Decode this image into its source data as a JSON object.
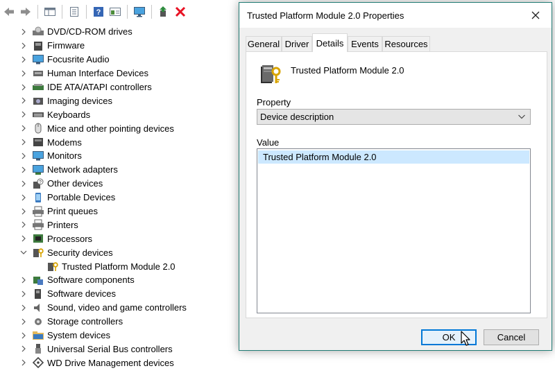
{
  "toolbar": {
    "icons": [
      "back-arrow-icon",
      "forward-arrow-icon",
      "console-tree-icon",
      "properties-icon",
      "help-icon",
      "view-icon",
      "monitor-icon",
      "update-driver-icon",
      "uninstall-icon"
    ]
  },
  "tree": {
    "items": [
      {
        "label": "DVD/CD-ROM drives",
        "icon": "dvd-drive-icon",
        "expanded": false
      },
      {
        "label": "Firmware",
        "icon": "firmware-icon",
        "expanded": false
      },
      {
        "label": "Focusrite Audio",
        "icon": "monitor-icon",
        "expanded": false
      },
      {
        "label": "Human Interface Devices",
        "icon": "hid-icon",
        "expanded": false
      },
      {
        "label": "IDE ATA/ATAPI controllers",
        "icon": "ide-controller-icon",
        "expanded": false
      },
      {
        "label": "Imaging devices",
        "icon": "camera-icon",
        "expanded": false
      },
      {
        "label": "Keyboards",
        "icon": "keyboard-icon",
        "expanded": false
      },
      {
        "label": "Mice and other pointing devices",
        "icon": "mouse-icon",
        "expanded": false
      },
      {
        "label": "Modems",
        "icon": "modem-icon",
        "expanded": false
      },
      {
        "label": "Monitors",
        "icon": "monitor-icon",
        "expanded": false
      },
      {
        "label": "Network adapters",
        "icon": "network-icon",
        "expanded": false
      },
      {
        "label": "Other devices",
        "icon": "unknown-device-icon",
        "expanded": false
      },
      {
        "label": "Portable Devices",
        "icon": "portable-device-icon",
        "expanded": false
      },
      {
        "label": "Print queues",
        "icon": "printer-icon",
        "expanded": false
      },
      {
        "label": "Printers",
        "icon": "printer-icon",
        "expanded": false
      },
      {
        "label": "Processors",
        "icon": "processor-icon",
        "expanded": false
      },
      {
        "label": "Security devices",
        "icon": "security-key-icon",
        "expanded": true
      },
      {
        "label": "Trusted Platform Module 2.0",
        "icon": "security-key-icon",
        "child": true
      },
      {
        "label": "Software components",
        "icon": "software-component-icon",
        "expanded": false
      },
      {
        "label": "Software devices",
        "icon": "software-device-icon",
        "expanded": false
      },
      {
        "label": "Sound, video and game controllers",
        "icon": "speaker-icon",
        "expanded": false
      },
      {
        "label": "Storage controllers",
        "icon": "storage-gear-icon",
        "expanded": false
      },
      {
        "label": "System devices",
        "icon": "folder-icon",
        "expanded": false
      },
      {
        "label": "Universal Serial Bus controllers",
        "icon": "usb-icon",
        "expanded": false
      },
      {
        "label": "WD Drive Management devices",
        "icon": "wd-diamond-icon",
        "expanded": false
      }
    ]
  },
  "dialog": {
    "title": "Trusted Platform Module 2.0 Properties",
    "tabs": [
      "General",
      "Driver",
      "Details",
      "Events",
      "Resources"
    ],
    "active_tab": "Details",
    "device_name": "Trusted Platform Module 2.0",
    "property_label": "Property",
    "property_value": "Device description",
    "value_label": "Value",
    "value_item": "Trusted Platform Module 2.0",
    "ok_label": "OK",
    "cancel_label": "Cancel"
  },
  "colors": {
    "dialog_border": "#1f7a73",
    "selection": "#cce8ff",
    "default_button_border": "#0078d7",
    "uninstall_red": "#e81123",
    "update_green": "#2e8b3d"
  }
}
